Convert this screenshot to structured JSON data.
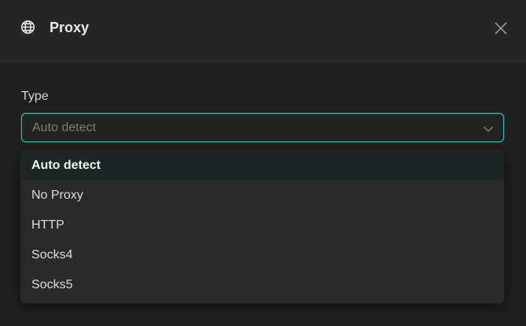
{
  "dialog": {
    "title": "Proxy",
    "icon": "globe-icon",
    "close_icon": "close-icon"
  },
  "form": {
    "type_label": "Type",
    "type_select": {
      "value": "Auto detect",
      "options": [
        "Auto detect",
        "No Proxy",
        "HTTP",
        "Socks4",
        "Socks5"
      ],
      "selected_index": 0
    }
  },
  "colors": {
    "accent": "#3fb6b0",
    "background": "#1f1f1f",
    "header": "#262626",
    "menu": "#2a2a2a"
  }
}
